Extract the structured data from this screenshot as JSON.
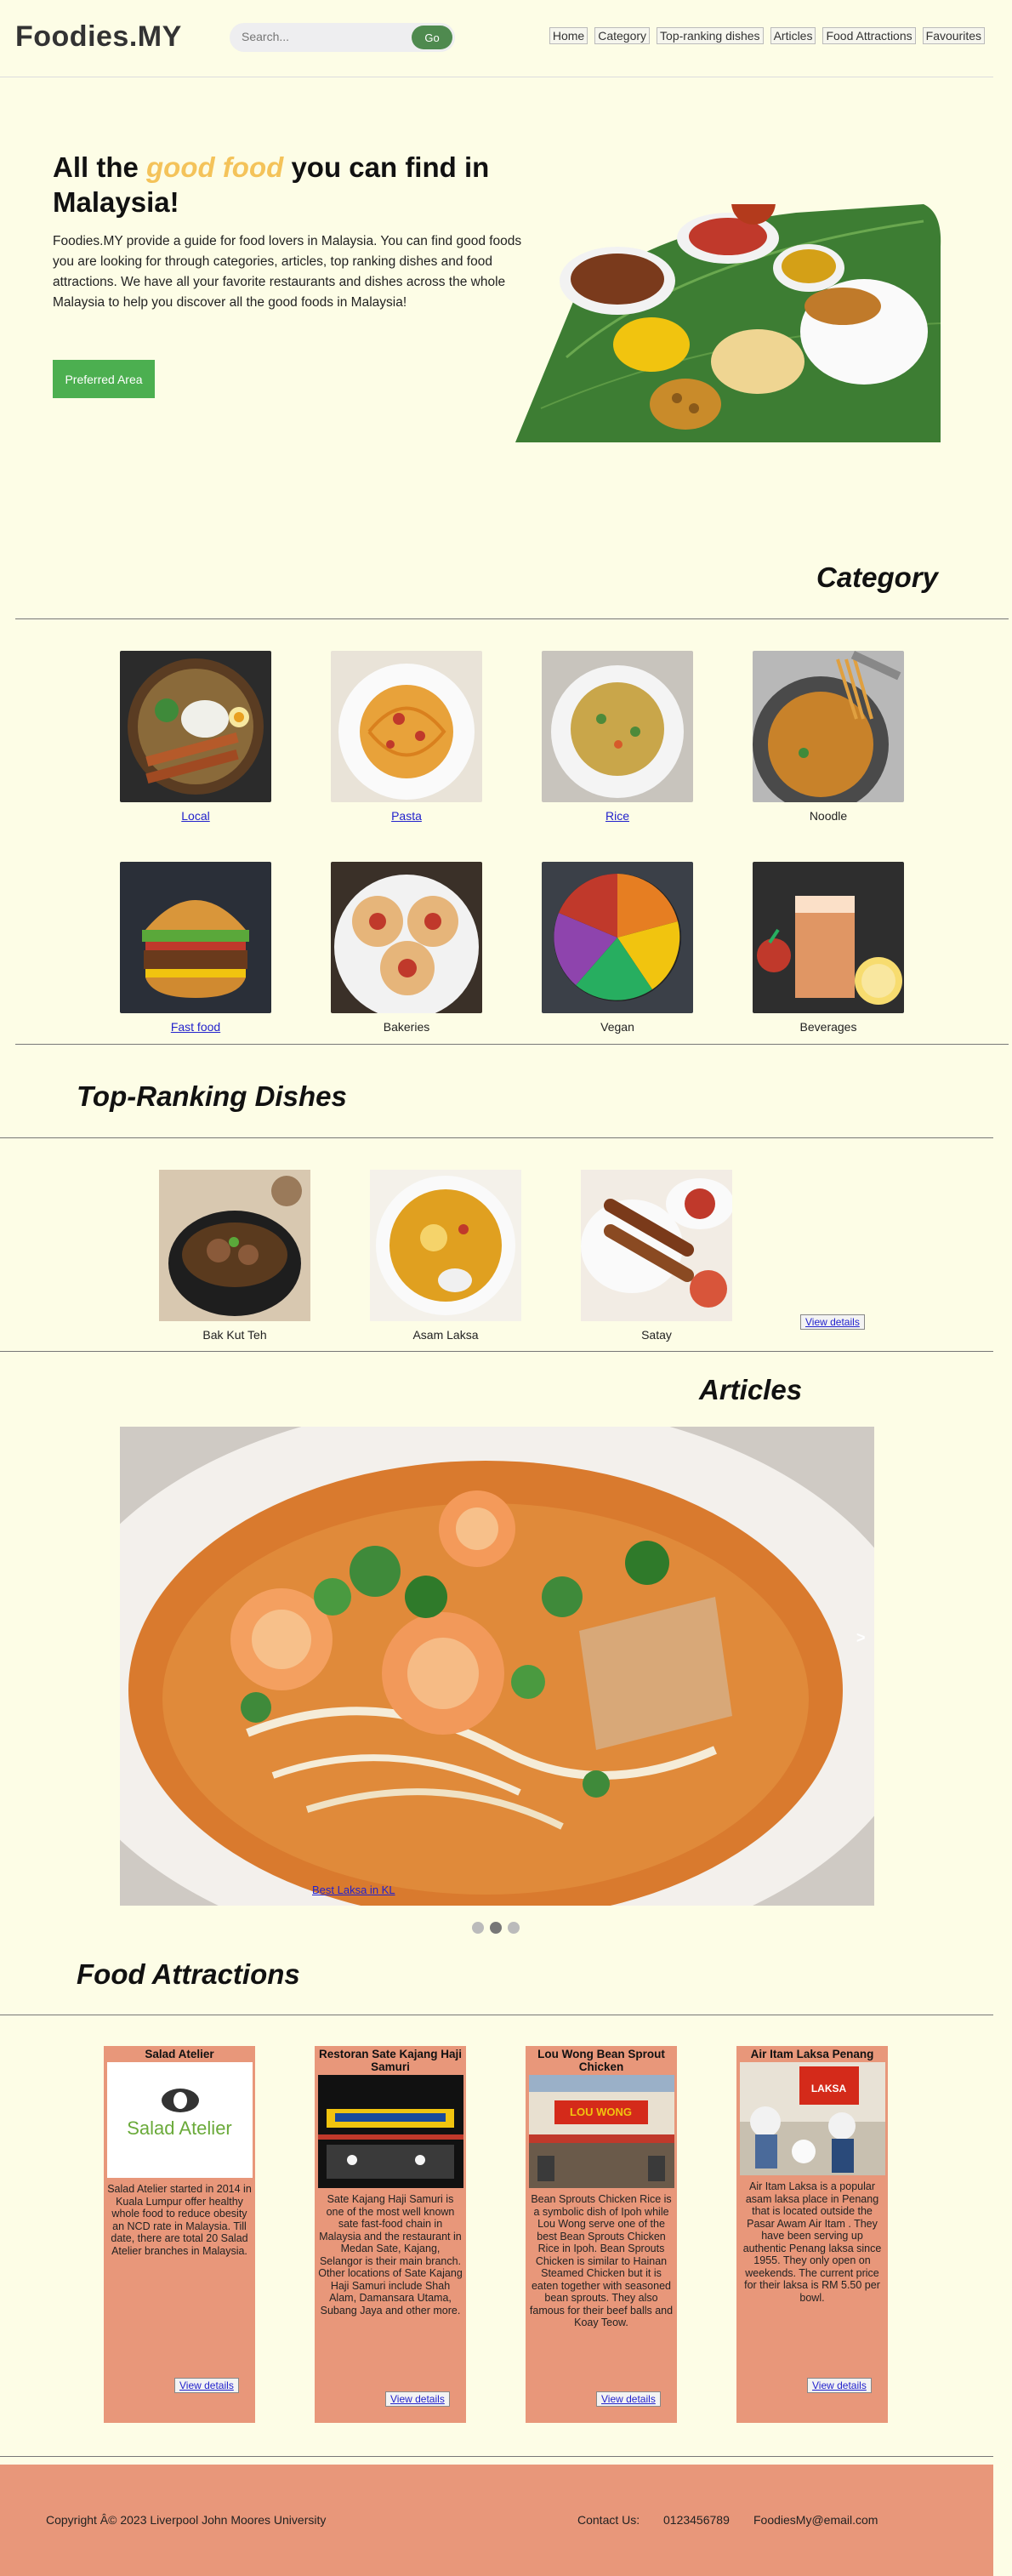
{
  "header": {
    "logo": "Foodies.MY",
    "search_placeholder": "Search...",
    "go_label": "Go",
    "nav": [
      "Home",
      "Category",
      "Top-ranking dishes",
      "Articles",
      "Food Attractions",
      "Favourites"
    ]
  },
  "hero": {
    "title_pre": "All the ",
    "title_highlight": "good food",
    "title_post": " you can find in Malaysia!",
    "description": "Foodies.MY provide a guide for food lovers in Malaysia. You can find good foods you are looking for through categories, articles, top ranking dishes and food attractions. We have all your favorite restaurants and dishes across the whole Malaysia to help you discover all the good foods in Malaysia!",
    "button": "Preferred Area"
  },
  "category": {
    "title": "Category",
    "items": [
      {
        "label": "Local",
        "link": true
      },
      {
        "label": "Pasta",
        "link": true
      },
      {
        "label": "Rice",
        "link": true
      },
      {
        "label": "Noodle",
        "link": false
      },
      {
        "label": "Fast food",
        "link": true
      },
      {
        "label": "Bakeries",
        "link": false
      },
      {
        "label": "Vegan",
        "link": false
      },
      {
        "label": "Beverages",
        "link": false
      }
    ]
  },
  "top_ranking": {
    "title": "Top-Ranking Dishes",
    "dishes": [
      "Bak Kut Teh",
      "Asam Laksa",
      "Satay"
    ],
    "view_details": "View details"
  },
  "articles": {
    "title": "Articles",
    "slide_caption": "Best Laksa in KL",
    "next_arrow": ">",
    "dot_count": 3,
    "active_dot": 2
  },
  "attractions": {
    "title": "Food Attractions",
    "view_details": "View details",
    "cards": [
      {
        "title": "Salad Atelier",
        "logo_text": "Salad Atelier",
        "description": "Salad Atelier started in 2014 in Kuala Lumpur offer healthy whole food to reduce obesity an NCD rate in Malaysia. Till date, there are total 20 Salad Atelier branches in Malaysia."
      },
      {
        "title": "Restoran Sate Kajang Haji Samuri",
        "description": "Sate Kajang Haji Samuri is one of the most well known sate fast-food chain in Malaysia and the restaurant in Medan Sate, Kajang, Selangor is their main branch. Other locations of Sate Kajang Haji Samuri include Shah Alam, Damansara Utama, Subang Jaya and other more."
      },
      {
        "title": "Lou Wong Bean Sprout Chicken",
        "sign_text": "LOU WONG",
        "description": "Bean Sprouts Chicken Rice is a symbolic dish of Ipoh while Lou Wong serve one of the best Bean Sprouts Chicken Rice in Ipoh. Bean Sprouts Chicken is similar to Hainan Steamed Chicken but it is eaten together with seasoned bean sprouts. They also famous for their beef balls and Koay Teow."
      },
      {
        "title": "Air Itam Laksa Penang",
        "sign_text": "LAKSA",
        "description": "Air Itam Laksa is a popular asam laksa place in Penang that is located outside the Pasar Awam Air Itam . They have been serving up authentic Penang laksa since 1955. They only open on weekends. The current price for their laksa is RM 5.50 per bowl."
      }
    ]
  },
  "footer": {
    "copyright": "Copyright Â© 2023 Liverpool John Moores University",
    "contact_label": "Contact Us:",
    "phone": "0123456789",
    "email": "FoodiesMy@email.com"
  }
}
